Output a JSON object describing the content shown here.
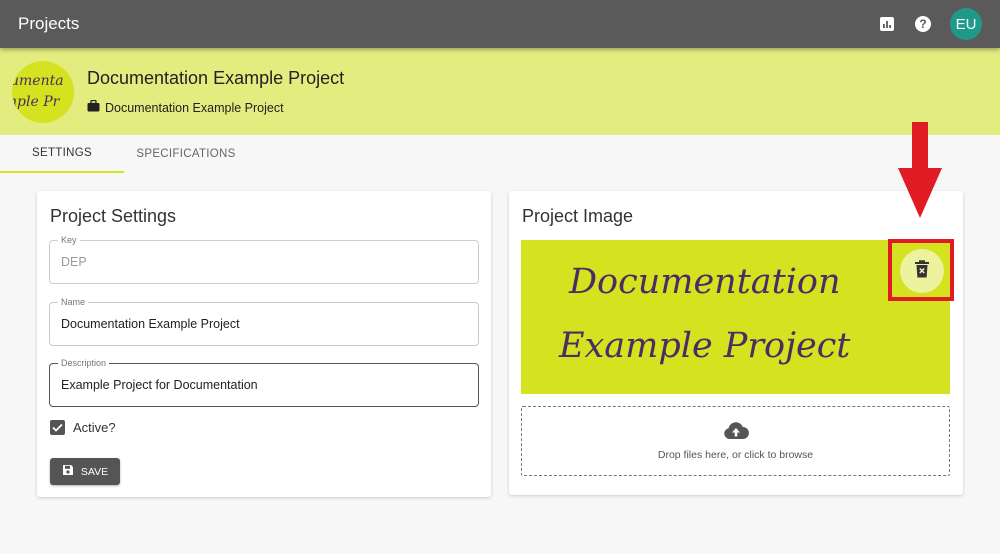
{
  "appbar": {
    "title": "Projects",
    "icons": [
      "bar-chart-icon",
      "help-icon"
    ],
    "avatar_initials": "EU"
  },
  "project": {
    "title": "Documentation Example Project",
    "subtitle": "Documentation Example Project",
    "logo_lines": [
      "umenta",
      "nple Pr"
    ]
  },
  "tabs": [
    {
      "label": "SETTINGS",
      "active": true
    },
    {
      "label": "SPECIFICATIONS",
      "active": false
    }
  ],
  "settings": {
    "card_title": "Project Settings",
    "fields": {
      "key": {
        "label": "Key",
        "value": "DEP",
        "disabled": true
      },
      "name": {
        "label": "Name",
        "value": "Documentation Example Project"
      },
      "description": {
        "label": "Description",
        "value": "Example Project for Documentation"
      }
    },
    "active_label": "Active?",
    "active_checked": true,
    "save_label": "SAVE"
  },
  "image_card": {
    "card_title": "Project Image",
    "image_lines": [
      "Documentation",
      "Example Project"
    ],
    "dropzone_text": "Drop files here, or click to browse"
  },
  "colors": {
    "appbar": "#5a5a5a",
    "header_band": "#e2ec7f",
    "logo_bg": "#d4e21f",
    "logo_text": "#4b2c63",
    "avatar": "#1f9a8a",
    "highlight": "#e01b24"
  }
}
